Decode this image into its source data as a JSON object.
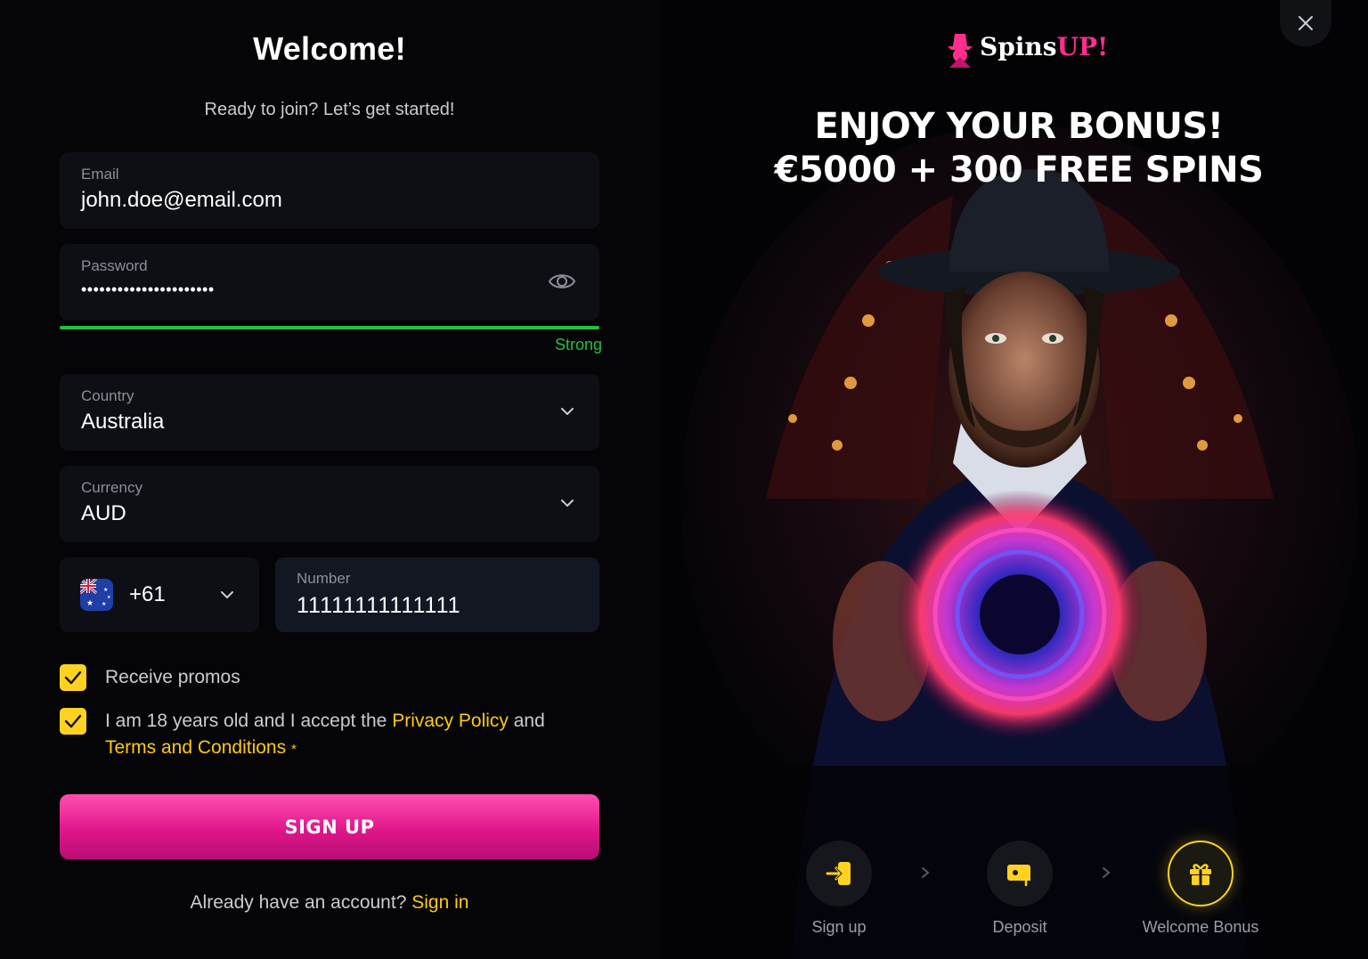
{
  "form": {
    "title": "Welcome!",
    "subtitle": "Ready to join? Let’s get started!",
    "email": {
      "label": "Email",
      "value": "john.doe@email.com"
    },
    "password": {
      "label": "Password",
      "value": "••••••••••••••••••••••",
      "strength": "Strong",
      "strength_color": "#22c33a"
    },
    "country": {
      "label": "Country",
      "value": "Australia"
    },
    "currency": {
      "label": "Currency",
      "value": "AUD"
    },
    "phone": {
      "code": "+61",
      "label": "Number",
      "value": "11111111111111",
      "flag_icon": "australia-flag-icon"
    },
    "promos": {
      "checked": true,
      "label": "Receive promos"
    },
    "terms": {
      "checked": true,
      "prefix": "I am 18 years old and I accept the ",
      "privacy_link": "Privacy Policy",
      "middle": " and",
      "terms_link": "Terms and Conditions",
      "required_mark": "*"
    },
    "signup_button": "SIGN UP",
    "signin": {
      "prompt": "Already have an account? ",
      "link": "Sign in"
    }
  },
  "promo": {
    "logo": {
      "text_main": "Spins",
      "text_accent": "UP!"
    },
    "title_line1": "ENJOY YOUR BONUS!",
    "title_line2": "€5000 + 300 FREE SPINS",
    "steps": [
      {
        "label": "Sign up",
        "icon": "sign-in-arrow-icon",
        "active": false
      },
      {
        "label": "Deposit",
        "icon": "wallet-deposit-icon",
        "active": false
      },
      {
        "label": "Welcome Bonus",
        "icon": "gift-icon",
        "active": true
      }
    ]
  },
  "colors": {
    "accent_yellow": "#ffc90e",
    "button_pink": "#e0168b",
    "strength_green": "#22c33a"
  }
}
